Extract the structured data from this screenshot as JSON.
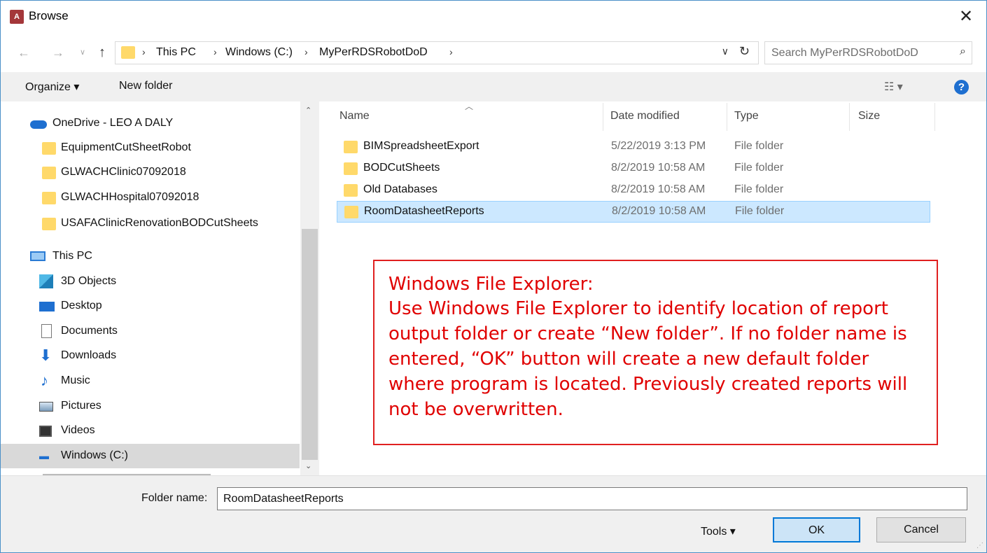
{
  "window": {
    "app_icon": "A",
    "title": "Browse",
    "close": "✕"
  },
  "address": {
    "crumbs": [
      "This PC",
      "Windows (C:)",
      "MyPerRDSRobotDoD"
    ],
    "search_placeholder": "Search MyPerRDSRobotDoD"
  },
  "toolbar": {
    "organize": "Organize ▾",
    "new_folder": "New folder",
    "view": "☷ ▾",
    "help": "?"
  },
  "nav": {
    "items": [
      {
        "label": "OneDrive - LEO A DALY",
        "icon": "onedrive-icon"
      },
      {
        "label": "EquipmentCutSheetRobot",
        "icon": "folder-icon"
      },
      {
        "label": "GLWACHClinic07092018",
        "icon": "folder-icon"
      },
      {
        "label": "GLWACHHospital07092018",
        "icon": "folder-icon"
      },
      {
        "label": "USAFAClinicRenovationBODCutSheets",
        "icon": "folder-icon"
      },
      {
        "label": "This PC",
        "icon": "this-pc-icon"
      },
      {
        "label": "3D Objects",
        "icon": "3d-objects-icon"
      },
      {
        "label": "Desktop",
        "icon": "desktop-icon"
      },
      {
        "label": "Documents",
        "icon": "documents-icon"
      },
      {
        "label": "Downloads",
        "icon": "downloads-icon"
      },
      {
        "label": "Music",
        "icon": "music-icon"
      },
      {
        "label": "Pictures",
        "icon": "pictures-icon"
      },
      {
        "label": "Videos",
        "icon": "videos-icon"
      },
      {
        "label": "Windows (C:)",
        "icon": "drive-icon",
        "selected": true
      }
    ]
  },
  "files": {
    "columns": {
      "name": "Name",
      "date": "Date modified",
      "type": "Type",
      "size": "Size"
    },
    "rows": [
      {
        "name": "BIMSpreadsheetExport",
        "date": "5/22/2019 3:13 PM",
        "type": "File folder"
      },
      {
        "name": "BODCutSheets",
        "date": "8/2/2019 10:58 AM",
        "type": "File folder"
      },
      {
        "name": "Old Databases",
        "date": "8/2/2019 10:58 AM",
        "type": "File folder"
      },
      {
        "name": "RoomDatasheetReports",
        "date": "8/2/2019 10:58 AM",
        "type": "File folder",
        "selected": true
      }
    ]
  },
  "callout": {
    "title": "Windows File Explorer:",
    "body": "Use Windows File Explorer to identify location of report output folder or create “New folder”.  If no folder name is entered, “OK” button will create a new default folder where program is located.  Previously created reports will not be overwritten."
  },
  "footer": {
    "folder_name_label": "Folder name:",
    "folder_name_value": "RoomDatasheetReports",
    "tools": "Tools  ▾",
    "ok": "OK",
    "cancel": "Cancel"
  },
  "colors": {
    "accent": "#0078d7",
    "selection": "#cce8ff",
    "callout": "#e00000"
  }
}
